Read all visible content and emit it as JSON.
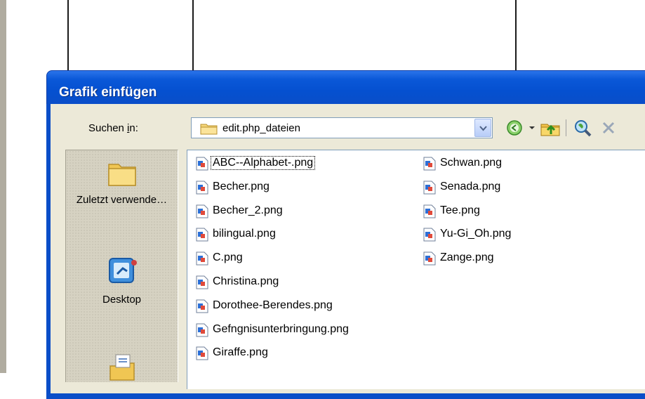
{
  "dialog": {
    "title": "Grafik einfügen"
  },
  "look_in": {
    "label_prefix": "Suchen ",
    "label_accel": "i",
    "label_suffix": "n:",
    "current_folder": "edit.php_dateien"
  },
  "toolbar": {
    "back_icon": "back-arrow-icon",
    "up_icon": "up-folder-icon",
    "search_icon": "search-web-icon",
    "delete_icon": "delete-icon"
  },
  "places": [
    {
      "label": "Zuletzt verwende…",
      "icon": "recent-folder-icon"
    },
    {
      "label": "Desktop",
      "icon": "desktop-icon"
    },
    {
      "label": "",
      "icon": "my-documents-icon"
    }
  ],
  "files_col1": [
    "ABC--Alphabet-.png",
    "Becher.png",
    "Becher_2.png",
    "bilingual.png",
    "C.png",
    "Christina.png",
    "Dorothee-Berendes.png",
    "Gefngnisunterbringung.png",
    "Giraffe.png"
  ],
  "files_col2": [
    "Schwan.png",
    "Senada.png",
    "Tee.png",
    "Yu-Gi_Oh.png",
    "Zange.png"
  ],
  "colors": {
    "titlebar": "#0a58d8",
    "dialog_bg": "#ece9d8",
    "list_border": "#7f9db9"
  }
}
